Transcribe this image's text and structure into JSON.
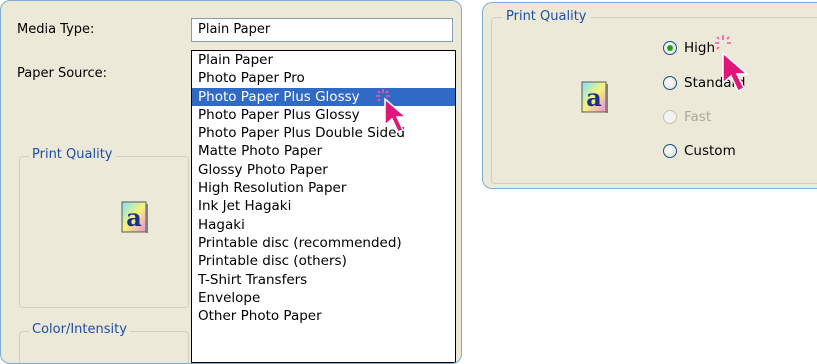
{
  "left_panel": {
    "media_type_label": "Media Type:",
    "paper_source_label": "Paper Source:",
    "media_type_value": "Plain Paper",
    "media_type_options": [
      "Plain Paper",
      "Photo Paper Pro",
      "Photo Paper Plus Glossy",
      "Photo Paper Plus Glossy",
      "Photo Paper Plus Double Sided",
      "Matte Photo Paper",
      "Glossy Photo Paper",
      "High Resolution Paper",
      "Ink Jet Hagaki",
      "Hagaki",
      "Printable disc (recommended)",
      "Printable disc (others)",
      "T-Shirt Transfers",
      "Envelope",
      "Other Photo Paper"
    ],
    "selected_index": 2,
    "print_quality_title": "Print Quality",
    "color_intensity_title": "Color/Intensity",
    "sample_glyph": "a"
  },
  "right_panel": {
    "print_quality_title": "Print Quality",
    "sample_glyph": "a",
    "options": [
      {
        "label": "High",
        "checked": true,
        "disabled": false
      },
      {
        "label": "Standard",
        "checked": false,
        "disabled": false
      },
      {
        "label": "Fast",
        "checked": false,
        "disabled": true
      },
      {
        "label": "Custom",
        "checked": false,
        "disabled": false
      }
    ]
  },
  "colors": {
    "accent": "#316ac5",
    "cursor": "#e0167a",
    "panel_border": "#7dadd1",
    "group_title": "#1f4ea6"
  },
  "icons": [
    "sample-a-icon",
    "pointer-cursor-icon",
    "click-burst-icon"
  ]
}
